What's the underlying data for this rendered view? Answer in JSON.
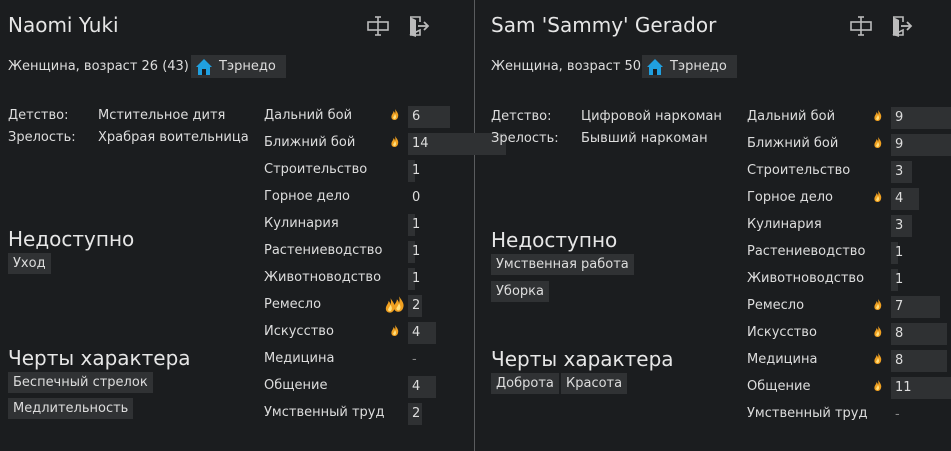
{
  "pawns": [
    {
      "name": "Naomi Yuki",
      "gender_age": "Женщина, возраст 26 (43)",
      "faction": "Тэрнедо",
      "backstory": [
        {
          "label": "Детство:",
          "value": "Мстительное дитя"
        },
        {
          "label": "Зрелость:",
          "value": "Храбрая воительница"
        }
      ],
      "disabled_title": "Недоступно",
      "disabled": [
        "Уход"
      ],
      "traits_title": "Черты характера",
      "traits": [
        "Беспечный стрелок",
        "Медлительность"
      ],
      "skills": [
        {
          "name": "Дальний бой",
          "value": "6",
          "passion": 1,
          "level": 6
        },
        {
          "name": "Ближний бой",
          "value": "14",
          "passion": 1,
          "level": 14
        },
        {
          "name": "Строительство",
          "value": "1",
          "passion": 0,
          "level": 1
        },
        {
          "name": "Горное дело",
          "value": "0",
          "passion": 0,
          "level": 0
        },
        {
          "name": "Кулинария",
          "value": "1",
          "passion": 0,
          "level": 1
        },
        {
          "name": "Растениеводство",
          "value": "1",
          "passion": 0,
          "level": 1
        },
        {
          "name": "Животноводство",
          "value": "1",
          "passion": 0,
          "level": 1
        },
        {
          "name": "Ремесло",
          "value": "2",
          "passion": 2,
          "level": 2
        },
        {
          "name": "Искусство",
          "value": "4",
          "passion": 1,
          "level": 4
        },
        {
          "name": "Медицина",
          "value": "-",
          "passion": 0,
          "level": 0
        },
        {
          "name": "Общение",
          "value": "4",
          "passion": 0,
          "level": 4
        },
        {
          "name": "Умственный труд",
          "value": "2",
          "passion": 0,
          "level": 2
        }
      ]
    },
    {
      "name": "Sam 'Sammy' Gerador",
      "gender_age": "Женщина, возраст 50",
      "faction": "Тэрнедо",
      "backstory": [
        {
          "label": "Детство:",
          "value": "Цифровой наркоман"
        },
        {
          "label": "Зрелость:",
          "value": "Бывший наркоман"
        }
      ],
      "disabled_title": "Недоступно",
      "disabled": [
        "Умственная работа",
        "Уборка"
      ],
      "traits_title": "Черты характера",
      "traits": [
        "Доброта",
        "Красота"
      ],
      "skills": [
        {
          "name": "Дальний бой",
          "value": "9",
          "passion": 1,
          "level": 9
        },
        {
          "name": "Ближний бой",
          "value": "9",
          "passion": 1,
          "level": 9
        },
        {
          "name": "Строительство",
          "value": "3",
          "passion": 0,
          "level": 3
        },
        {
          "name": "Горное дело",
          "value": "4",
          "passion": 1,
          "level": 4
        },
        {
          "name": "Кулинария",
          "value": "3",
          "passion": 0,
          "level": 3
        },
        {
          "name": "Растениеводство",
          "value": "1",
          "passion": 0,
          "level": 1
        },
        {
          "name": "Животноводство",
          "value": "1",
          "passion": 0,
          "level": 1
        },
        {
          "name": "Ремесло",
          "value": "7",
          "passion": 1,
          "level": 7
        },
        {
          "name": "Искусство",
          "value": "8",
          "passion": 1,
          "level": 8
        },
        {
          "name": "Медицина",
          "value": "8",
          "passion": 1,
          "level": 8
        },
        {
          "name": "Общение",
          "value": "11",
          "passion": 1,
          "level": 11
        },
        {
          "name": "Умственный труд",
          "value": "-",
          "passion": 0,
          "level": 0
        }
      ]
    }
  ]
}
